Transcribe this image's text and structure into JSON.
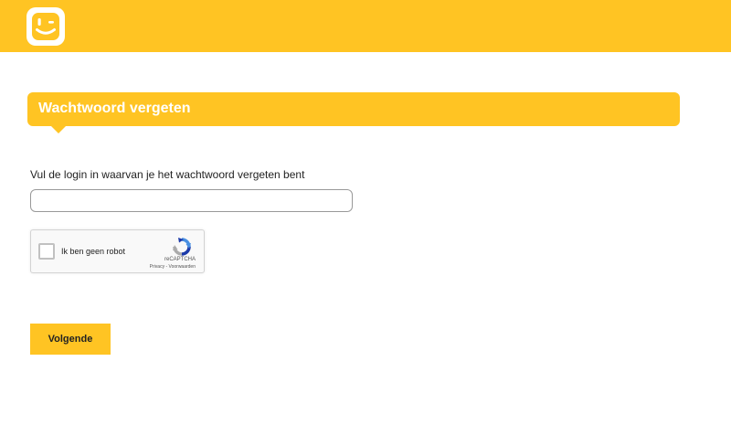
{
  "header": {
    "logo_icon": "telenet-smiley-logo-icon",
    "bar_color": "#FFC423"
  },
  "section": {
    "title": "Wachtwoord vergeten"
  },
  "form": {
    "login_label": "Vul de login in waarvan je het wachtwoord vergeten bent",
    "login_value": "",
    "login_placeholder": ""
  },
  "recaptcha": {
    "label": "Ik ben geen robot",
    "brand": "reCAPTCHA",
    "privacy_link": "Privacy",
    "separator": " - ",
    "terms_link": "Voorwaarden",
    "logo_icon": "recaptcha-logo-icon",
    "checked": false
  },
  "actions": {
    "next_label": "Volgende",
    "button_color": "#FFC423"
  }
}
